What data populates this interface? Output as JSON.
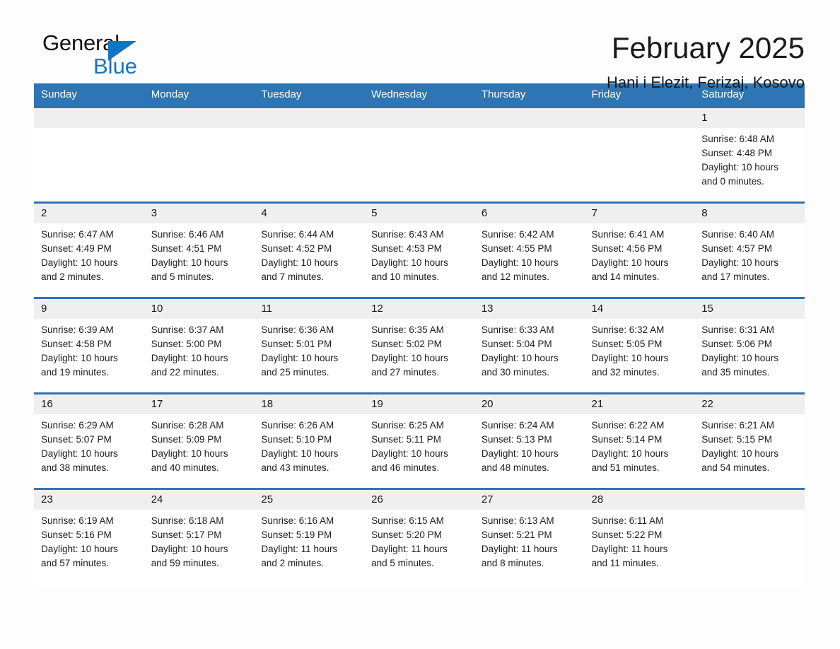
{
  "brand": {
    "name_dark": "General",
    "name_light": "Blue",
    "triangle_color": "#1474c4"
  },
  "header": {
    "title": "February 2025",
    "location": "Hani i Elezit, Ferizaj, Kosovo",
    "accent_color": "#2e75b6",
    "band_color": "#efefef"
  },
  "calendar": {
    "weekday_headers": [
      "Sunday",
      "Monday",
      "Tuesday",
      "Wednesday",
      "Thursday",
      "Friday",
      "Saturday"
    ],
    "weeks": [
      [
        {
          "day": "",
          "lines": []
        },
        {
          "day": "",
          "lines": []
        },
        {
          "day": "",
          "lines": []
        },
        {
          "day": "",
          "lines": []
        },
        {
          "day": "",
          "lines": []
        },
        {
          "day": "",
          "lines": []
        },
        {
          "day": "1",
          "lines": [
            "Sunrise: 6:48 AM",
            "Sunset: 4:48 PM",
            "Daylight: 10 hours",
            "and 0 minutes."
          ]
        }
      ],
      [
        {
          "day": "2",
          "lines": [
            "Sunrise: 6:47 AM",
            "Sunset: 4:49 PM",
            "Daylight: 10 hours",
            "and 2 minutes."
          ]
        },
        {
          "day": "3",
          "lines": [
            "Sunrise: 6:46 AM",
            "Sunset: 4:51 PM",
            "Daylight: 10 hours",
            "and 5 minutes."
          ]
        },
        {
          "day": "4",
          "lines": [
            "Sunrise: 6:44 AM",
            "Sunset: 4:52 PM",
            "Daylight: 10 hours",
            "and 7 minutes."
          ]
        },
        {
          "day": "5",
          "lines": [
            "Sunrise: 6:43 AM",
            "Sunset: 4:53 PM",
            "Daylight: 10 hours",
            "and 10 minutes."
          ]
        },
        {
          "day": "6",
          "lines": [
            "Sunrise: 6:42 AM",
            "Sunset: 4:55 PM",
            "Daylight: 10 hours",
            "and 12 minutes."
          ]
        },
        {
          "day": "7",
          "lines": [
            "Sunrise: 6:41 AM",
            "Sunset: 4:56 PM",
            "Daylight: 10 hours",
            "and 14 minutes."
          ]
        },
        {
          "day": "8",
          "lines": [
            "Sunrise: 6:40 AM",
            "Sunset: 4:57 PM",
            "Daylight: 10 hours",
            "and 17 minutes."
          ]
        }
      ],
      [
        {
          "day": "9",
          "lines": [
            "Sunrise: 6:39 AM",
            "Sunset: 4:58 PM",
            "Daylight: 10 hours",
            "and 19 minutes."
          ]
        },
        {
          "day": "10",
          "lines": [
            "Sunrise: 6:37 AM",
            "Sunset: 5:00 PM",
            "Daylight: 10 hours",
            "and 22 minutes."
          ]
        },
        {
          "day": "11",
          "lines": [
            "Sunrise: 6:36 AM",
            "Sunset: 5:01 PM",
            "Daylight: 10 hours",
            "and 25 minutes."
          ]
        },
        {
          "day": "12",
          "lines": [
            "Sunrise: 6:35 AM",
            "Sunset: 5:02 PM",
            "Daylight: 10 hours",
            "and 27 minutes."
          ]
        },
        {
          "day": "13",
          "lines": [
            "Sunrise: 6:33 AM",
            "Sunset: 5:04 PM",
            "Daylight: 10 hours",
            "and 30 minutes."
          ]
        },
        {
          "day": "14",
          "lines": [
            "Sunrise: 6:32 AM",
            "Sunset: 5:05 PM",
            "Daylight: 10 hours",
            "and 32 minutes."
          ]
        },
        {
          "day": "15",
          "lines": [
            "Sunrise: 6:31 AM",
            "Sunset: 5:06 PM",
            "Daylight: 10 hours",
            "and 35 minutes."
          ]
        }
      ],
      [
        {
          "day": "16",
          "lines": [
            "Sunrise: 6:29 AM",
            "Sunset: 5:07 PM",
            "Daylight: 10 hours",
            "and 38 minutes."
          ]
        },
        {
          "day": "17",
          "lines": [
            "Sunrise: 6:28 AM",
            "Sunset: 5:09 PM",
            "Daylight: 10 hours",
            "and 40 minutes."
          ]
        },
        {
          "day": "18",
          "lines": [
            "Sunrise: 6:26 AM",
            "Sunset: 5:10 PM",
            "Daylight: 10 hours",
            "and 43 minutes."
          ]
        },
        {
          "day": "19",
          "lines": [
            "Sunrise: 6:25 AM",
            "Sunset: 5:11 PM",
            "Daylight: 10 hours",
            "and 46 minutes."
          ]
        },
        {
          "day": "20",
          "lines": [
            "Sunrise: 6:24 AM",
            "Sunset: 5:13 PM",
            "Daylight: 10 hours",
            "and 48 minutes."
          ]
        },
        {
          "day": "21",
          "lines": [
            "Sunrise: 6:22 AM",
            "Sunset: 5:14 PM",
            "Daylight: 10 hours",
            "and 51 minutes."
          ]
        },
        {
          "day": "22",
          "lines": [
            "Sunrise: 6:21 AM",
            "Sunset: 5:15 PM",
            "Daylight: 10 hours",
            "and 54 minutes."
          ]
        }
      ],
      [
        {
          "day": "23",
          "lines": [
            "Sunrise: 6:19 AM",
            "Sunset: 5:16 PM",
            "Daylight: 10 hours",
            "and 57 minutes."
          ]
        },
        {
          "day": "24",
          "lines": [
            "Sunrise: 6:18 AM",
            "Sunset: 5:17 PM",
            "Daylight: 10 hours",
            "and 59 minutes."
          ]
        },
        {
          "day": "25",
          "lines": [
            "Sunrise: 6:16 AM",
            "Sunset: 5:19 PM",
            "Daylight: 11 hours",
            "and 2 minutes."
          ]
        },
        {
          "day": "26",
          "lines": [
            "Sunrise: 6:15 AM",
            "Sunset: 5:20 PM",
            "Daylight: 11 hours",
            "and 5 minutes."
          ]
        },
        {
          "day": "27",
          "lines": [
            "Sunrise: 6:13 AM",
            "Sunset: 5:21 PM",
            "Daylight: 11 hours",
            "and 8 minutes."
          ]
        },
        {
          "day": "28",
          "lines": [
            "Sunrise: 6:11 AM",
            "Sunset: 5:22 PM",
            "Daylight: 11 hours",
            "and 11 minutes."
          ]
        },
        {
          "day": "",
          "lines": []
        }
      ]
    ]
  }
}
